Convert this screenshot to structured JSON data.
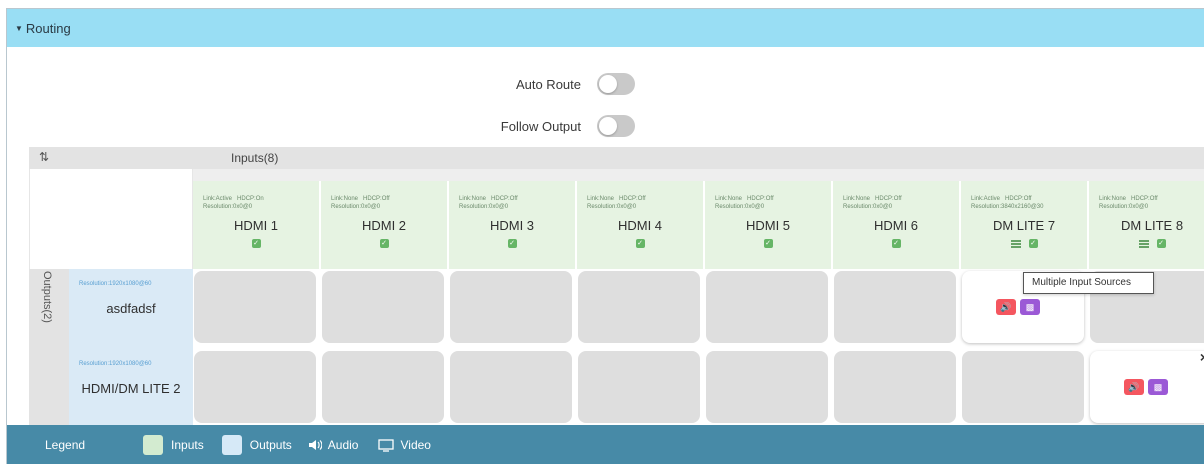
{
  "section": {
    "title": "Routing"
  },
  "toggles": [
    {
      "label": "Auto Route",
      "on": false
    },
    {
      "label": "Follow Output",
      "on": false
    }
  ],
  "matrix": {
    "inputs_title": "Inputs(8)",
    "outputs_title": "Outputs(2)",
    "inputs": [
      {
        "link": "Link:Active",
        "hdcp": "HDCP:On",
        "resolution": "Resolution:0x0@0",
        "name": "HDMI 1",
        "multi": false
      },
      {
        "link": "Link:None",
        "hdcp": "HDCP:Off",
        "resolution": "Resolution:0x0@0",
        "name": "HDMI 2",
        "multi": false
      },
      {
        "link": "Link:None",
        "hdcp": "HDCP:Off",
        "resolution": "Resolution:0x0@0",
        "name": "HDMI 3",
        "multi": false
      },
      {
        "link": "Link:None",
        "hdcp": "HDCP:Off",
        "resolution": "Resolution:0x0@0",
        "name": "HDMI 4",
        "multi": false
      },
      {
        "link": "Link:None",
        "hdcp": "HDCP:Off",
        "resolution": "Resolution:0x0@0",
        "name": "HDMI 5",
        "multi": false
      },
      {
        "link": "Link:None",
        "hdcp": "HDCP:Off",
        "resolution": "Resolution:0x0@0",
        "name": "HDMI 6",
        "multi": false
      },
      {
        "link": "Link:Active",
        "hdcp": "HDCP:Off",
        "resolution": "Resolution:3840x2160@30",
        "name": "DM LITE 7",
        "multi": true
      },
      {
        "link": "Link:None",
        "hdcp": "HDCP:Off",
        "resolution": "Resolution:0x0@0",
        "name": "DM LITE 8",
        "multi": true
      }
    ],
    "outputs": [
      {
        "resolution": "Resolution:1920x1080@60",
        "name": "asdfadsf",
        "routed_input": 6
      },
      {
        "resolution": "Resolution:1920x1080@60",
        "name": "HDMI/DM LITE 2",
        "routed_input": 7
      }
    ],
    "tooltip": "Multiple Input Sources"
  },
  "legend": {
    "title": "Legend",
    "inputs": "Inputs",
    "outputs": "Outputs",
    "audio": "Audio",
    "video": "Video"
  },
  "colors": {
    "header_bg": "#99def4",
    "input_header": "#e6f3e2",
    "output_header": "#daeaf6",
    "legend_bg": "#478aa7",
    "audio_badge": "#f4565f",
    "video_badge": "#9b59d6"
  }
}
